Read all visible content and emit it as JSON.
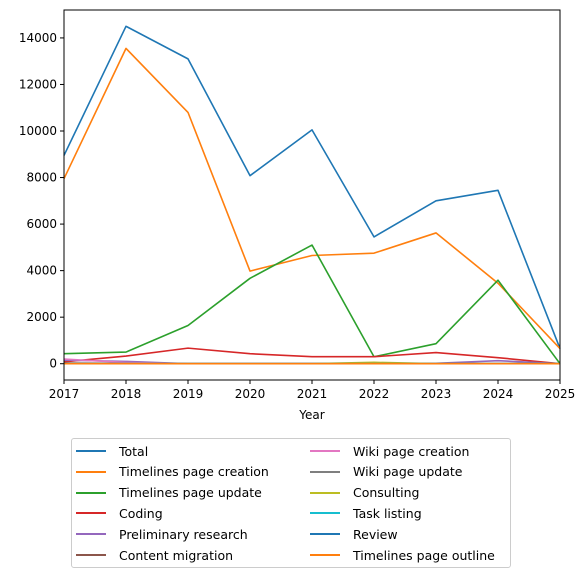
{
  "chart_data": {
    "type": "line",
    "title": "",
    "xlabel": "Year",
    "ylabel": "",
    "x": [
      2017,
      2018,
      2019,
      2020,
      2021,
      2022,
      2023,
      2024,
      2025
    ],
    "xlim": [
      2017,
      2025
    ],
    "ylim": [
      -700,
      15200
    ],
    "x_ticks": [
      "2017",
      "2018",
      "2019",
      "2020",
      "2021",
      "2022",
      "2023",
      "2024",
      "2025"
    ],
    "y_ticks": [
      0,
      2000,
      4000,
      6000,
      8000,
      10000,
      12000,
      14000
    ],
    "y_tick_labels": [
      "0",
      "2000",
      "4000",
      "6000",
      "8000",
      "10000",
      "12000",
      "14000"
    ],
    "grid": false,
    "legend_placement": "bottom-center (below axes, 2 columns)",
    "series": [
      {
        "name": "Total",
        "color": "#1f77b4",
        "values": [
          8950,
          14500,
          13100,
          8080,
          10050,
          5450,
          7000,
          7450,
          650
        ]
      },
      {
        "name": "Timelines page creation",
        "color": "#ff7f0e",
        "values": [
          7950,
          13550,
          10800,
          3980,
          4650,
          4750,
          5620,
          3460,
          650
        ]
      },
      {
        "name": "Timelines page update",
        "color": "#2ca02c",
        "values": [
          430,
          500,
          1640,
          3670,
          5100,
          300,
          860,
          3590,
          0
        ]
      },
      {
        "name": "Coding",
        "color": "#d62728",
        "values": [
          80,
          330,
          670,
          430,
          300,
          300,
          480,
          260,
          0
        ]
      },
      {
        "name": "Preliminary research",
        "color": "#9467bd",
        "values": [
          150,
          100,
          0,
          0,
          0,
          0,
          20,
          130,
          0
        ]
      },
      {
        "name": "Content migration",
        "color": "#8c564b",
        "values": [
          30,
          20,
          0,
          0,
          0,
          0,
          0,
          0,
          0
        ]
      },
      {
        "name": "Wiki page creation",
        "color": "#e377c2",
        "values": [
          200,
          50,
          0,
          0,
          0,
          0,
          0,
          0,
          0
        ]
      },
      {
        "name": "Wiki page update",
        "color": "#7f7f7f",
        "values": [
          20,
          10,
          0,
          0,
          0,
          0,
          0,
          0,
          0
        ]
      },
      {
        "name": "Consulting",
        "color": "#bcbd22",
        "values": [
          0,
          0,
          0,
          0,
          0,
          60,
          0,
          0,
          0
        ]
      },
      {
        "name": "Task listing",
        "color": "#17becf",
        "values": [
          0,
          0,
          0,
          0,
          0,
          0,
          0,
          0,
          0
        ]
      },
      {
        "name": "Review",
        "color": "#1f77b4",
        "values": [
          0,
          0,
          0,
          0,
          0,
          0,
          0,
          0,
          0
        ]
      },
      {
        "name": "Timelines page outline",
        "color": "#ff7f0e",
        "values": [
          0,
          0,
          0,
          0,
          0,
          0,
          0,
          0,
          0
        ]
      }
    ]
  }
}
